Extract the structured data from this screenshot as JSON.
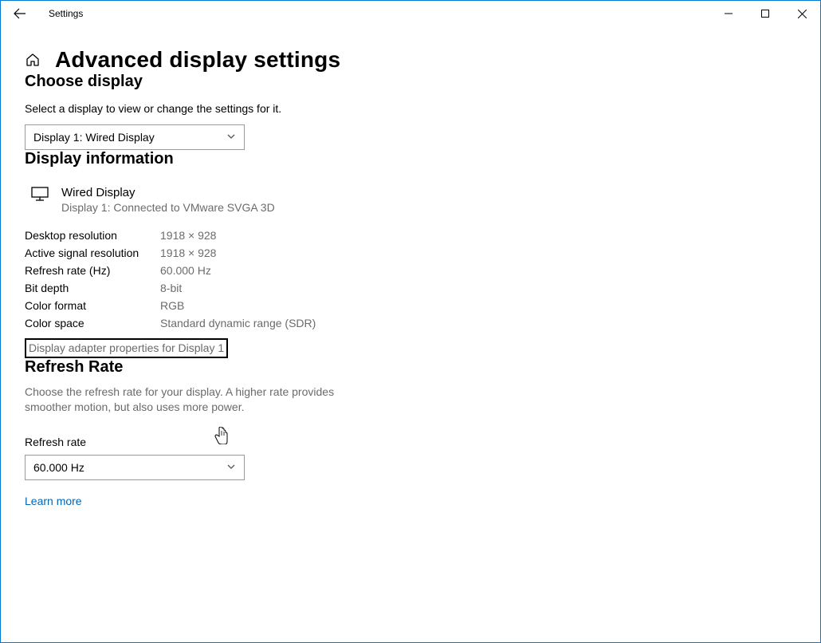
{
  "window": {
    "title": "Settings"
  },
  "page": {
    "title": "Advanced display settings"
  },
  "choose": {
    "heading": "Choose display",
    "subtext": "Select a display to view or change the settings for it.",
    "selected": "Display 1: Wired Display"
  },
  "info": {
    "heading": "Display information",
    "display_name": "Wired Display",
    "display_sub": "Display 1: Connected to VMware SVGA 3D",
    "rows": [
      {
        "label": "Desktop resolution",
        "value": "1918 × 928"
      },
      {
        "label": "Active signal resolution",
        "value": "1918 × 928"
      },
      {
        "label": "Refresh rate (Hz)",
        "value": "60.000 Hz"
      },
      {
        "label": "Bit depth",
        "value": "8-bit"
      },
      {
        "label": "Color format",
        "value": "RGB"
      },
      {
        "label": "Color space",
        "value": "Standard dynamic range (SDR)"
      }
    ],
    "adapter_link": "Display adapter properties for Display 1"
  },
  "refresh": {
    "heading": "Refresh Rate",
    "desc": "Choose the refresh rate for your display. A higher rate provides smoother motion, but also uses more power.",
    "label": "Refresh rate",
    "selected": "60.000 Hz",
    "learn_more": "Learn more"
  }
}
